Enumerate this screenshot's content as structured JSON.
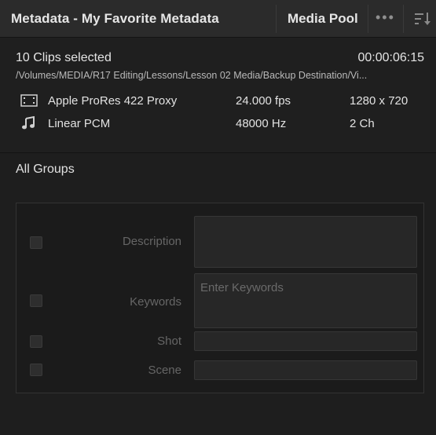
{
  "header": {
    "title": "Metadata - My Favorite Metadata",
    "media_pool": "Media Pool",
    "more_menu": "•••",
    "sort_icon": "sort-descending-icon"
  },
  "clip_info": {
    "clips_selected": "10 Clips selected",
    "duration": "00:00:06:15",
    "path": "/Volumes/MEDIA/R17 Editing/Lessons/Lesson 02 Media/Backup Destination/Vi...",
    "video": {
      "icon": "film-strip-icon",
      "codec": "Apple ProRes 422 Proxy",
      "fps": "24.000 fps",
      "resolution": "1280 x 720"
    },
    "audio": {
      "icon": "music-note-icon",
      "codec": "Linear PCM",
      "sample_rate": "48000 Hz",
      "channels": "2 Ch"
    }
  },
  "groups": {
    "label": "All Groups",
    "fields": [
      {
        "label": "Description",
        "value": ""
      },
      {
        "label": "Keywords",
        "value": "",
        "placeholder": "Enter Keywords"
      },
      {
        "label": "Shot",
        "value": ""
      },
      {
        "label": "Scene",
        "value": ""
      }
    ]
  },
  "colors": {
    "background": "#1e1e1e",
    "header": "#2b2b2b",
    "text": "#e2e2e2",
    "muted_label": "#666666",
    "field": "#272727"
  }
}
